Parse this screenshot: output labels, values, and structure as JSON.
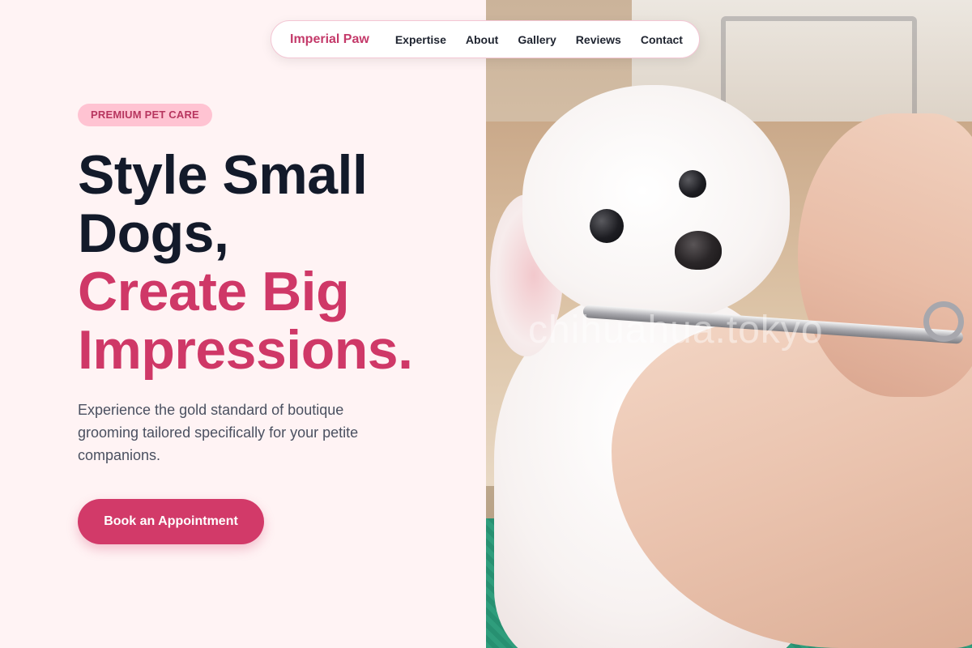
{
  "nav": {
    "brand": "Imperial Paw",
    "links": [
      "Expertise",
      "About",
      "Gallery",
      "Reviews",
      "Contact"
    ]
  },
  "hero": {
    "badge": "PREMIUM PET CARE",
    "headline_line1": "Style Small",
    "headline_line2": "Dogs,",
    "headline_accent1": "Create Big",
    "headline_accent2": "Impressions.",
    "subtext": "Experience the gold standard of boutique grooming tailored specifically for your petite companions.",
    "cta_label": "Book an Appointment"
  },
  "image": {
    "watermark": "chihuahua.tokyo"
  },
  "colors": {
    "accent": "#cf3867",
    "brand": "#c43a6a",
    "heading": "#131a2a",
    "background": "#fff3f4",
    "badge_bg": "#ffc3d2"
  }
}
